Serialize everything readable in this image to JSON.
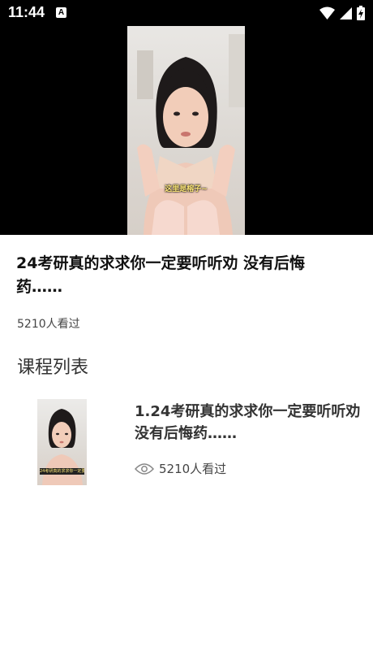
{
  "status_bar": {
    "time": "11:44",
    "app_icon_letter": "A",
    "icons": [
      "wifi-icon",
      "cellular-signal-icon",
      "battery-charging-icon"
    ]
  },
  "video": {
    "subtitle": "这里是榕子~"
  },
  "video_info": {
    "title": "24考研真的求求你一定要听听劝 没有后悔药……",
    "views": "5210人看过"
  },
  "course_list": {
    "heading": "课程列表",
    "items": [
      {
        "title": "1.24考研真的求求你一定要听听劝 没有后悔药……",
        "views": "5210人看过",
        "thumbnail_caption": "24考研真的求求你一定要听听劝"
      }
    ]
  },
  "colors": {
    "status_bar_bg": "#000000",
    "video_bg": "#000000",
    "title_text": "#111111",
    "subtitle_text": "#ffe97a",
    "eye_icon": "#888888"
  }
}
